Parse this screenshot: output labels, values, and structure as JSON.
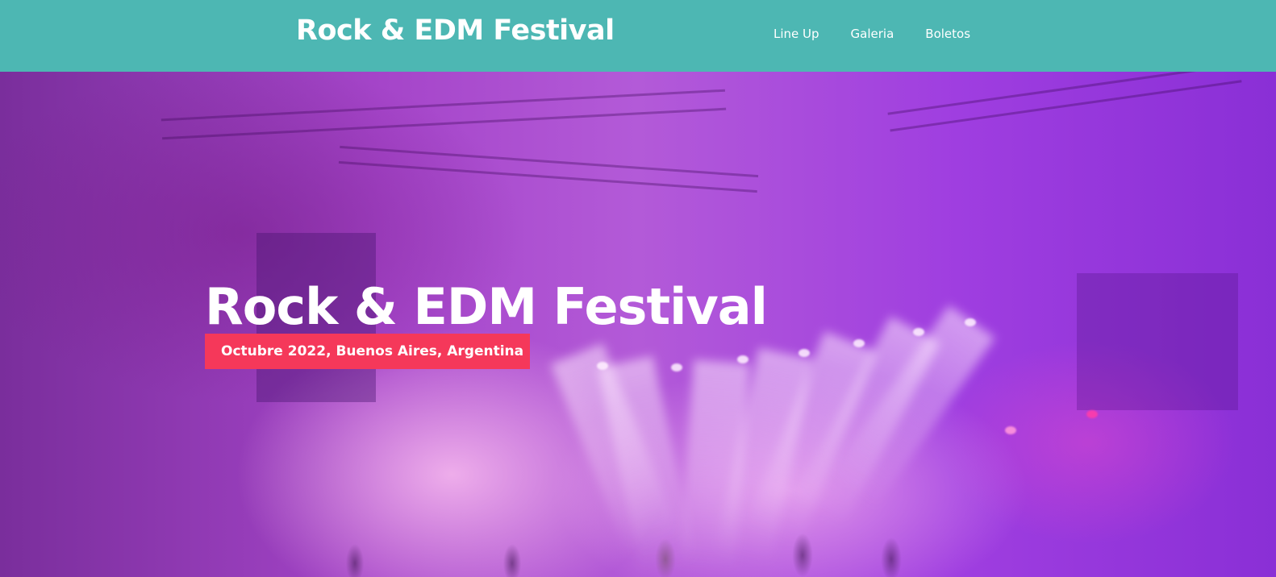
{
  "header": {
    "title": "Rock & EDM Festival",
    "background_color": "#4db7b3",
    "nav": [
      {
        "label": "Line Up"
      },
      {
        "label": "Galeria"
      },
      {
        "label": "Boletos"
      }
    ]
  },
  "hero": {
    "title": "Rock & EDM Festival",
    "subtitle": "Octubre 2022, Buenos Aires, Argentina",
    "badge_color": "#f5385a",
    "image": "concert-stage-purple-lights"
  }
}
